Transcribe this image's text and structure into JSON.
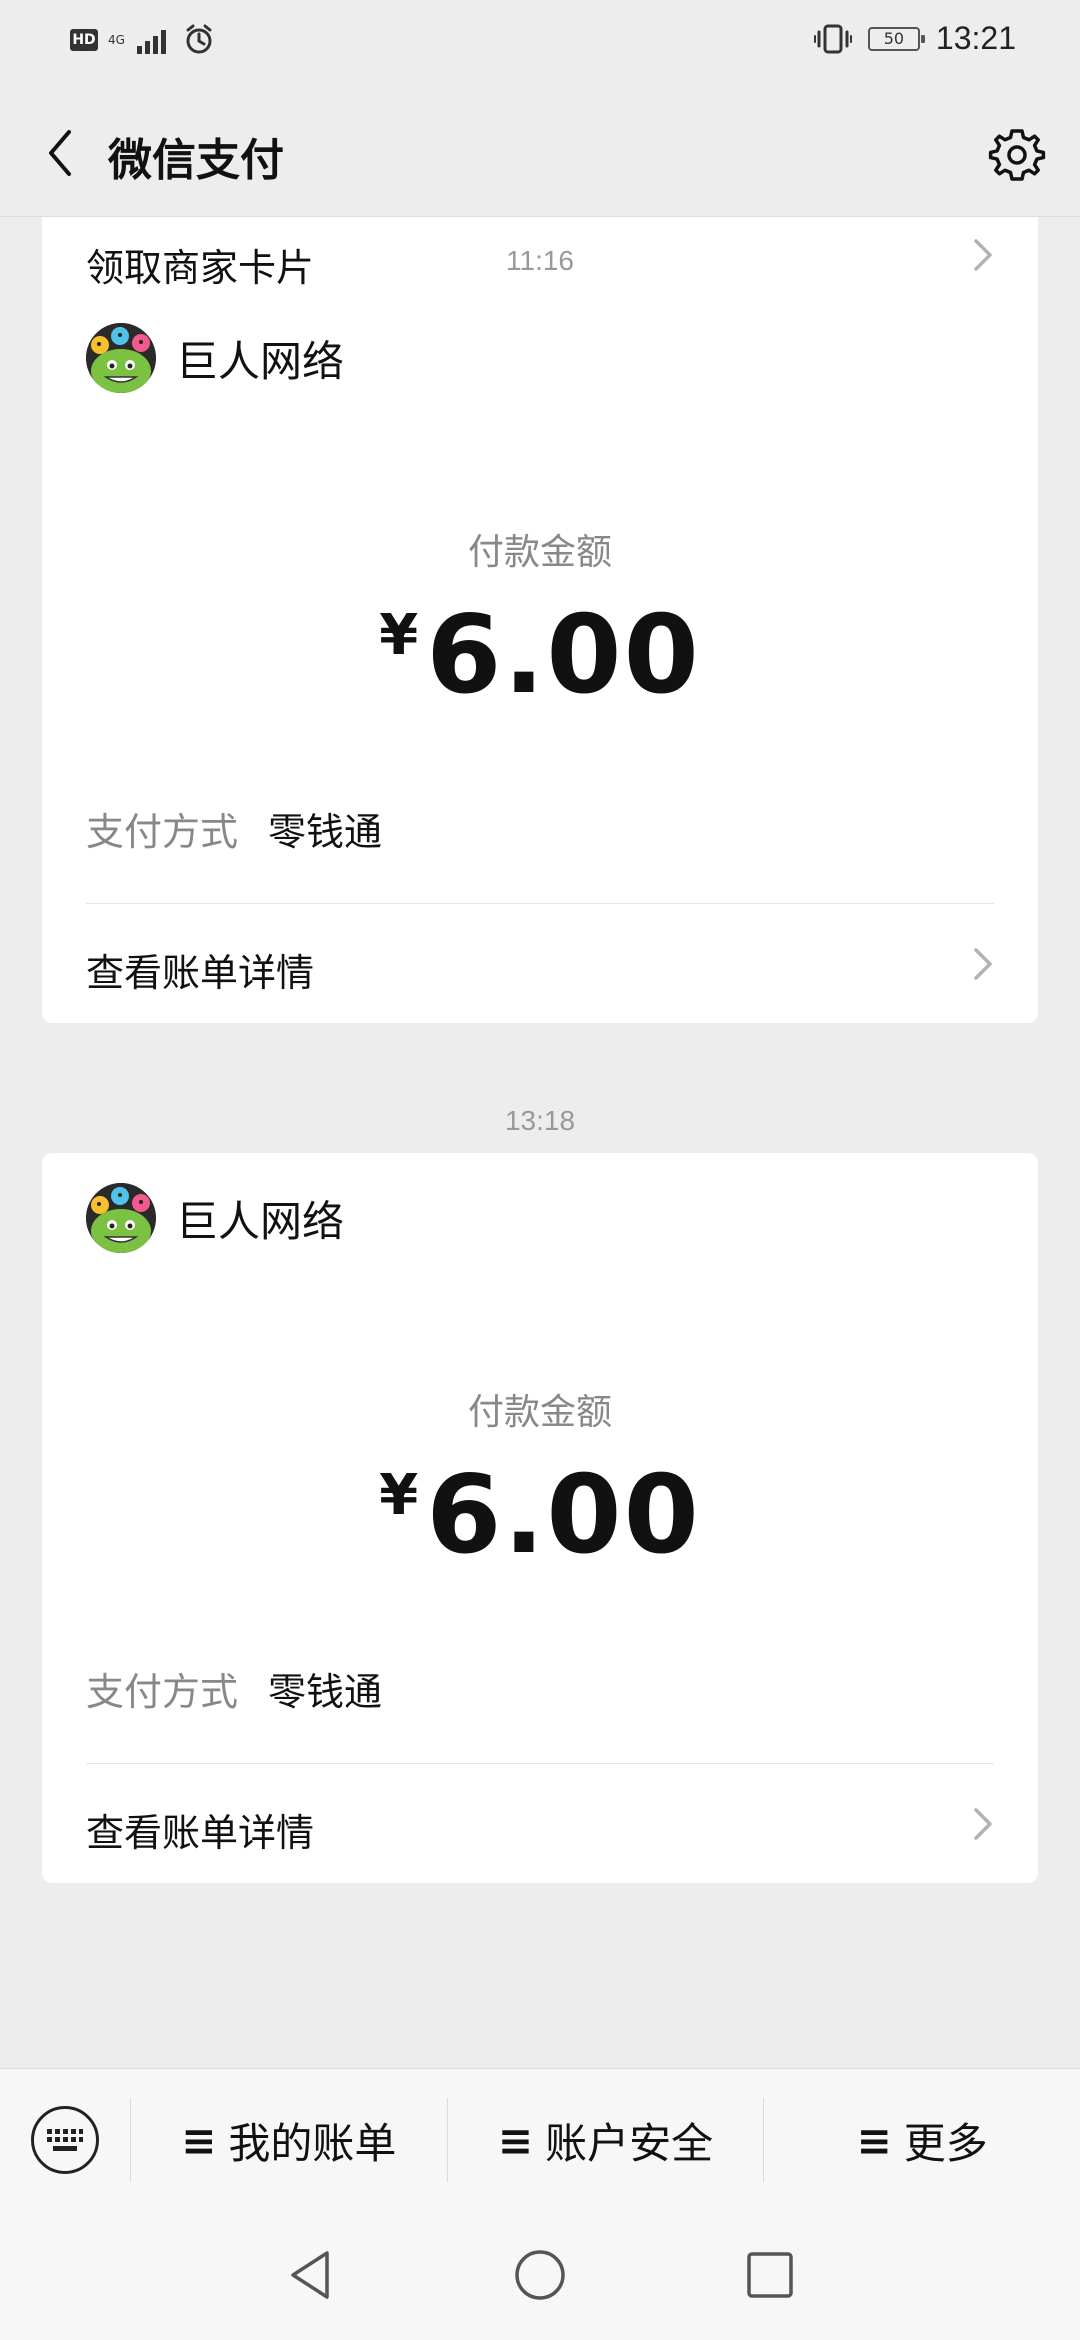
{
  "status_bar": {
    "hd_label": "HD",
    "network_label": "4G",
    "battery_level": "50",
    "time": "13:21",
    "icons": [
      "hd-icon",
      "signal-icon",
      "alarm-icon",
      "vibrate-icon",
      "battery-icon"
    ]
  },
  "header": {
    "title": "微信支付",
    "back_icon": "back-chevron-icon",
    "settings_icon": "gear-icon"
  },
  "feed": {
    "previous_card": {
      "label": "领取商家卡片"
    },
    "messages": [
      {
        "timestamp": "11:16",
        "merchant": "巨人网络",
        "amount_label": "付款金额",
        "currency_symbol": "¥",
        "amount": "6.00",
        "pay_method_label": "支付方式",
        "pay_method_value": "零钱通",
        "detail_link": "查看账单详情"
      },
      {
        "timestamp": "13:18",
        "merchant": "巨人网络",
        "amount_label": "付款金额",
        "currency_symbol": "¥",
        "amount": "6.00",
        "pay_method_label": "支付方式",
        "pay_method_value": "零钱通",
        "detail_link": "查看账单详情"
      }
    ]
  },
  "bottom_menu": {
    "keyboard_icon": "keyboard-icon",
    "items": [
      {
        "icon": "≡",
        "label": "我的账单"
      },
      {
        "icon": "≡",
        "label": "账户安全"
      },
      {
        "icon": "≡",
        "label": "更多"
      }
    ]
  },
  "nav_bar": {
    "buttons": [
      "back-triangle-icon",
      "home-circle-icon",
      "recents-square-icon"
    ]
  },
  "colors": {
    "background": "#ededed",
    "card": "#ffffff",
    "muted_text": "#888888",
    "primary_text": "#111111"
  }
}
